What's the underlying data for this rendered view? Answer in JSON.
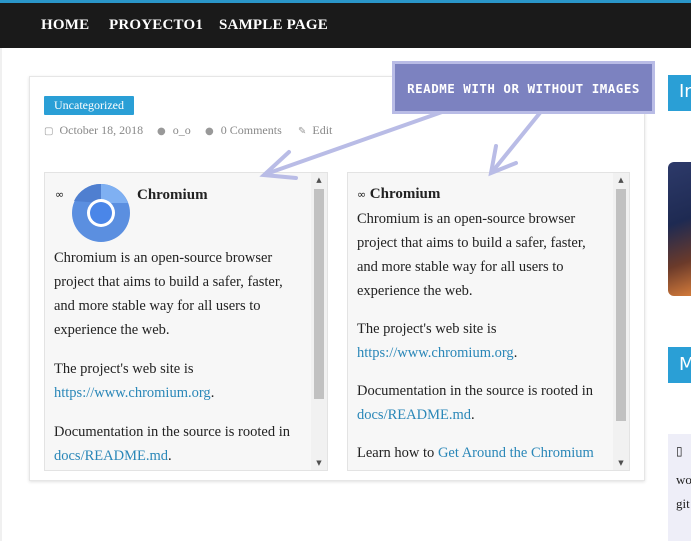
{
  "nav": {
    "items": [
      "HOME",
      "PROYECTO1",
      "SAMPLE PAGE"
    ]
  },
  "post": {
    "category": "Uncategorized",
    "date": "October 18, 2018",
    "author": "o_o",
    "comments": "0 Comments",
    "edit": "Edit"
  },
  "annotation": {
    "text": "README WITH OR WITHOUT IMAGES"
  },
  "left_panel": {
    "title": "Chromium",
    "p1": "Chromium is an open-source browser project that aims to build a safer, faster, and more stable way for all users to experience the web.",
    "p2_prefix": "The project's web site is ",
    "p2_link": "https://www.chromium.org",
    "p2_suffix": ".",
    "p3_prefix": "Documentation in the source is rooted in ",
    "p3_link": "docs/README.md",
    "p3_suffix": "."
  },
  "right_panel": {
    "title": "Chromium",
    "p1": "Chromium is an open-source browser project that aims to build a safer, faster, and more stable way for all users to experience the web.",
    "p2_prefix": "The project's web site is ",
    "p2_link": "https://www.chromium.org",
    "p2_suffix": ".",
    "p3_prefix": "Documentation in the source is rooted in ",
    "p3_link": "docs/README.md",
    "p3_suffix": ".",
    "p4_prefix": "Learn how to ",
    "p4_link": "Get Around the Chromium"
  },
  "sidebar": {
    "widget1_label": "In",
    "widget2_label": "M",
    "box_line1": "wo",
    "box_line2": "git"
  },
  "icons": {
    "date": "calendar-icon",
    "author": "user-icon",
    "comments": "comment-icon",
    "edit": "edit-icon",
    "link": "link-icon"
  },
  "colors": {
    "accent": "#2a9fd6",
    "nav_bg": "#1a1a1a",
    "annotation": "#7c82c0",
    "link": "#2a87b8"
  }
}
